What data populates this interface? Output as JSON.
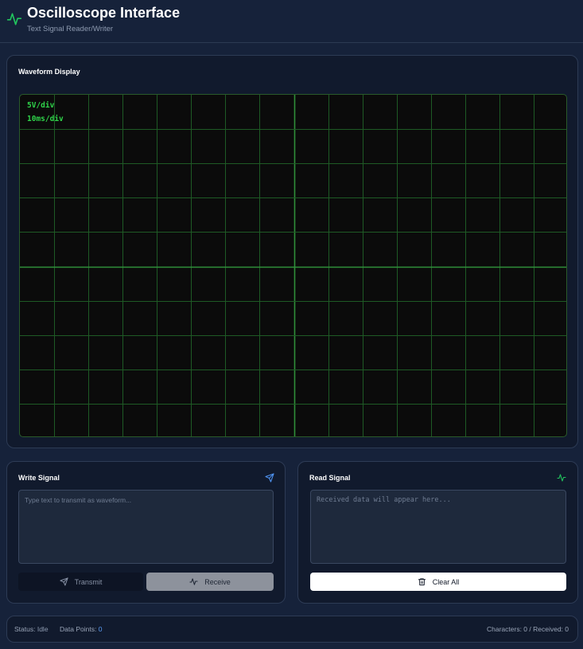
{
  "header": {
    "title": "Oscilloscope Interface",
    "subtitle": "Text Signal Reader/Writer",
    "logo_icon": "activity-icon",
    "accent": "#22c55e"
  },
  "waveform": {
    "title": "Waveform Display",
    "volts_per_div": "5V/div",
    "time_per_div": "10ms/div",
    "grid_color": "#1e5a25",
    "center_color": "#2f8f3a",
    "background": "#0b0b0b"
  },
  "write": {
    "title": "Write Signal",
    "icon": "send-icon",
    "placeholder": "Type text to transmit as waveform...",
    "value": "",
    "transmit_label": "Transmit",
    "receive_label": "Receive"
  },
  "read": {
    "title": "Read Signal",
    "icon": "activity-icon",
    "placeholder": "Received data will appear here...",
    "value": "",
    "clear_label": "Clear All"
  },
  "status": {
    "status_label": "Status:",
    "status_value": "Idle",
    "points_label": "Data Points:",
    "points_value": "0",
    "counts": "Characters: 0 / Received: 0"
  }
}
